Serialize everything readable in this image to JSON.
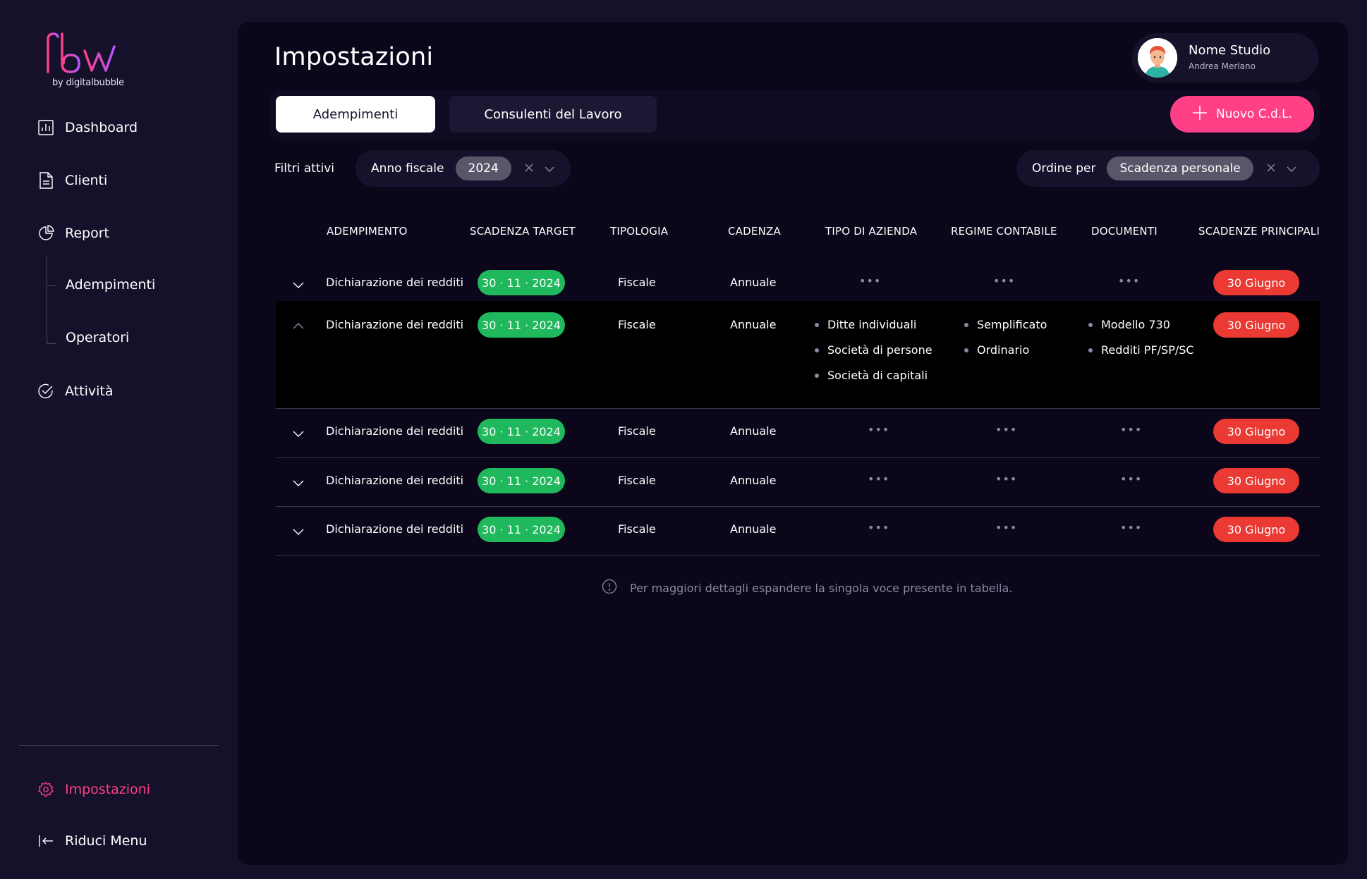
{
  "brand": {
    "logo_text": "flow",
    "sub": "by digitalbubble",
    "accent": "#ff3f86"
  },
  "sidebar": {
    "items": [
      {
        "label": "Dashboard",
        "icon": "chart-icon"
      },
      {
        "label": "Clienti",
        "icon": "document-icon"
      },
      {
        "label": "Report",
        "icon": "pie-chart-icon"
      }
    ],
    "report_sub": [
      "Adempimenti",
      "Operatori"
    ],
    "attivita": "Attività",
    "impostazioni": "Impostazioni",
    "riduci": "Riduci Menu"
  },
  "header": {
    "title": "Impostazioni",
    "user_name": "Nome Studio",
    "user_sub": "Andrea Merlano"
  },
  "tabs": {
    "active": "Adempimenti",
    "inactive": "Consulenti del Lavoro"
  },
  "new_button": "Nuovo C.d.L.",
  "filters": {
    "label": "Filtri attivi",
    "anno_label": "Anno fiscale",
    "anno_value": "2024",
    "ordine_label": "Ordine per",
    "ordine_value": "Scadenza personale"
  },
  "table": {
    "headers": [
      "ADEMPIMENTO",
      "SCADENZA TARGET",
      "TIPOLOGIA",
      "CADENZA",
      "TIPO DI AZIENDA",
      "REGIME CONTABILE",
      "DOCUMENTI",
      "SCADENZE PRINCIPALI"
    ],
    "rows": [
      {
        "name": "Dichiarazione dei redditi",
        "date": "30 · 11 · 2024",
        "tipologia": "Fiscale",
        "cadenza": "Annuale",
        "scadenza": "30 Giugno"
      },
      {
        "name": "Dichiarazione dei redditi",
        "date": "30 · 11 · 2024",
        "tipologia": "Fiscale",
        "cadenza": "Annuale",
        "scadenza": "30 Giugno",
        "tipo_azienda": [
          "Ditte individuali",
          "Società di persone",
          "Società di capitali"
        ],
        "regime": [
          "Semplificato",
          "Ordinario"
        ],
        "documenti": [
          "Modello 730",
          "Redditi PF/SP/SC"
        ]
      },
      {
        "name": "Dichiarazione dei redditi",
        "date": "30 · 11 · 2024",
        "tipologia": "Fiscale",
        "cadenza": "Annuale",
        "scadenza": "30 Giugno"
      },
      {
        "name": "Dichiarazione dei redditi",
        "date": "30 · 11 · 2024",
        "tipologia": "Fiscale",
        "cadenza": "Annuale",
        "scadenza": "30 Giugno"
      },
      {
        "name": "Dichiarazione dei redditi",
        "date": "30 · 11 · 2024",
        "tipologia": "Fiscale",
        "cadenza": "Annuale",
        "scadenza": "30 Giugno"
      }
    ],
    "collapsed_placeholder": "•••"
  },
  "note": "Per maggiori dettagli espandere la singola voce presente in tabella."
}
